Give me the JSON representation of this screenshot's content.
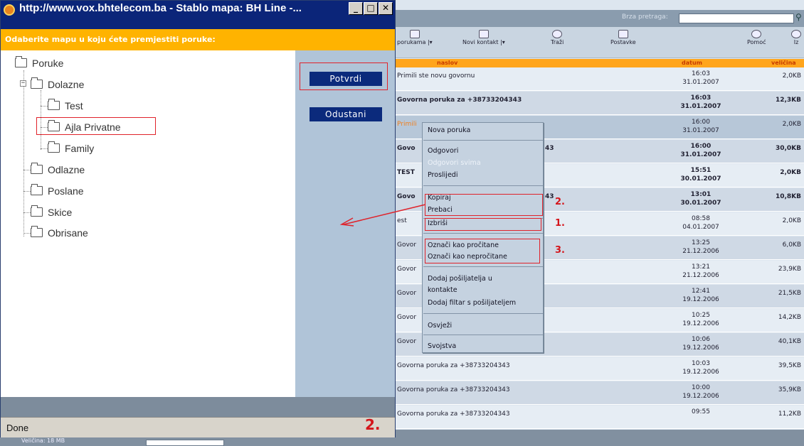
{
  "popup": {
    "title": "http://www.vox.bhtelecom.ba - Stablo mapa: BH Line -...",
    "instruction": "Odaberite mapu u koju ćete premjestiti poruke:",
    "tree": [
      {
        "label": "Poruke"
      },
      {
        "label": "Dolazne",
        "expander": "−"
      },
      {
        "label": "Test"
      },
      {
        "label": "Ajla Privatne"
      },
      {
        "label": "Family"
      },
      {
        "label": "Odlazne"
      },
      {
        "label": "Poslane"
      },
      {
        "label": "Skice"
      },
      {
        "label": "Obrisane"
      }
    ],
    "confirm_label": "Potvrdi",
    "cancel_label": "Odustani",
    "status": "Done",
    "status_marker": "2."
  },
  "app": {
    "search_label": "Brza pretraga:",
    "search_value": "",
    "toolbar": [
      {
        "label": "porukama |▾"
      },
      {
        "label": "Novi kontakt |▾"
      },
      {
        "label": "Traži"
      },
      {
        "label": "Postavke"
      },
      {
        "label": "Pomoć"
      },
      {
        "label": "Iz"
      }
    ],
    "columns": {
      "subject": "naslov",
      "date": "datum",
      "size": "veličina"
    },
    "rows": [
      {
        "subject": "Primili ste novu govornu",
        "time": "16:03",
        "date": "31.01.2007",
        "size": "2,0KB"
      },
      {
        "subject": "Govorna poruka za +38733204343",
        "time": "16:03",
        "date": "31.01.2007",
        "size": "12,3KB"
      },
      {
        "subject": "Primili",
        "time": "16:00",
        "date": "31.01.2007",
        "size": "2,0KB"
      },
      {
        "subject": "Govo",
        "subject_tail": "43",
        "time": "16:00",
        "date": "31.01.2007",
        "size": "30,0KB"
      },
      {
        "subject": "TEST",
        "time": "15:51",
        "date": "30.01.2007",
        "size": "2,0KB"
      },
      {
        "subject": "Govo",
        "subject_tail": "43",
        "time": "13:01",
        "date": "30.01.2007",
        "size": "10,8KB"
      },
      {
        "subject": "est",
        "time": "08:58",
        "date": "04.01.2007",
        "size": "2,0KB"
      },
      {
        "subject": "Govor",
        "time": "13:25",
        "date": "21.12.2006",
        "size": "6,0KB"
      },
      {
        "subject": "Govor",
        "time": "13:21",
        "date": "21.12.2006",
        "size": "23,9KB"
      },
      {
        "subject": "Govor",
        "time": "12:41",
        "date": "19.12.2006",
        "size": "21,5KB"
      },
      {
        "subject": "Govor",
        "time": "10:25",
        "date": "19.12.2006",
        "size": "14,2KB"
      },
      {
        "subject": "Govor",
        "time": "10:06",
        "date": "19.12.2006",
        "size": "40,1KB"
      },
      {
        "subject": "Govorna poruka za +38733204343",
        "time": "10:03",
        "date": "19.12.2006",
        "size": "39,5KB"
      },
      {
        "subject": "Govorna poruka za +38733204343",
        "time": "10:00",
        "date": "19.12.2006",
        "size": "35,9KB"
      },
      {
        "subject": "Govorna poruka za +38733204343",
        "time": "09:55",
        "date": "",
        "size": "11,2KB"
      }
    ],
    "footer_text": "Veličina: 18 MB"
  },
  "context_menu": {
    "items": [
      {
        "label": "Nova poruka"
      },
      {
        "label": "Odgovori"
      },
      {
        "label": "Odgovori svima",
        "disabled": true
      },
      {
        "label": "Proslijedi"
      },
      {
        "label": "Kopiraj"
      },
      {
        "label": "Prebaci"
      },
      {
        "label": "Izbriši"
      },
      {
        "label": "Označi kao pročitane"
      },
      {
        "label": "Označi kao nepročitane"
      },
      {
        "label": "Dodaj pošiljatelja u"
      },
      {
        "label": "kontakte"
      },
      {
        "label": "Dodaj filtar s pošiljateljem"
      },
      {
        "label": "Osvježi"
      },
      {
        "label": "Svojstva"
      }
    ],
    "annotations": [
      "2.",
      "1.",
      "3."
    ]
  },
  "colors": {
    "titlebar": "#0b2579",
    "instruction_bar": "#ffb300",
    "button": "#0b2a7c",
    "highlight_box": "#e0222a"
  }
}
